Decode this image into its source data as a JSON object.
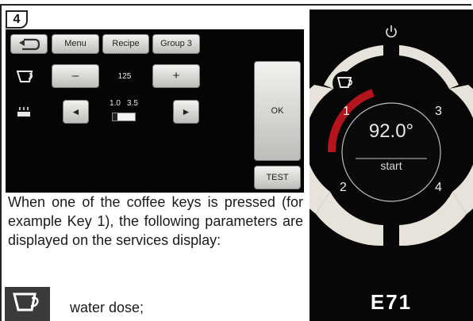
{
  "step_number": "4",
  "panel": {
    "back_label": "",
    "menu_label": "Menu",
    "recipe_label": "Recipe",
    "group_label": "Group 3",
    "minus_label": "–",
    "dose_value": "125",
    "plus_label": "+",
    "left_label": "◄",
    "right_label": "►",
    "range_low": "1.0",
    "range_high": "3.5",
    "ok_label": "OK",
    "test_label": "TEST",
    "icons": [
      "back-arrow-icon",
      "cup-icon",
      "heater-icon"
    ]
  },
  "description": "When one of the coffee keys is pressed (for example Key 1), the following parameters are displayed on the services display:",
  "param_row": {
    "icon": "cup-icon",
    "text": "water dose;"
  },
  "machine": {
    "temperature": "92.0°",
    "start_label": "start",
    "key1": "1",
    "key2": "2",
    "key3": "3",
    "key4": "4",
    "model": "E71",
    "icons": [
      "power-icon",
      "cup-icon"
    ],
    "accent_color": "#b4141c"
  }
}
